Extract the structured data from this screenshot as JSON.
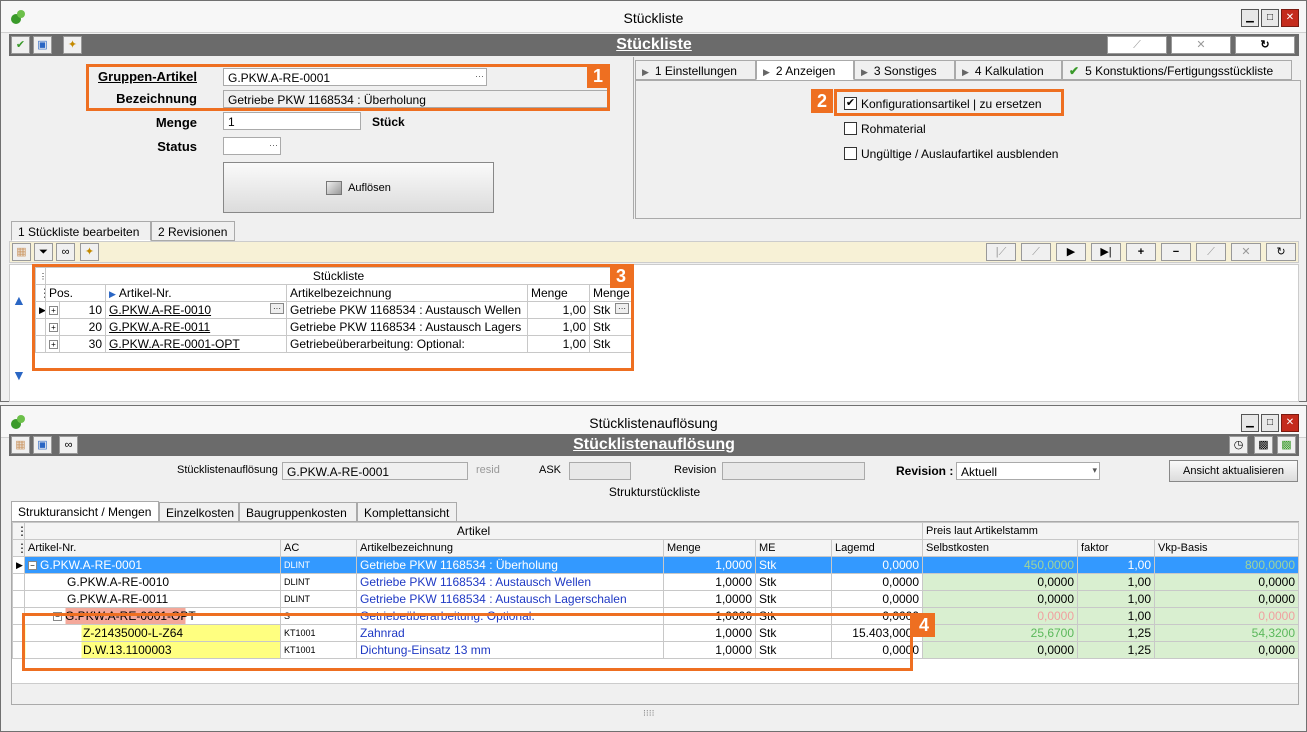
{
  "win1": {
    "title": "Stückliste",
    "header": "Stückliste",
    "form": {
      "gruppen_artikel_label": "Gruppen-Artikel",
      "gruppen_artikel_value": "G.PKW.A-RE-0001",
      "bezeichnung_label": "Bezeichnung",
      "bezeichnung_value": "Getriebe PKW 1168534 : Überholung",
      "menge_label": "Menge",
      "menge_value": "1",
      "menge_unit": "Stück",
      "status_label": "Status",
      "resolve_button": "Auflösen"
    },
    "right_tabs": [
      "1 Einstellungen",
      "2 Anzeigen",
      "3 Sonstiges",
      "4 Kalkulation",
      "5 Konstuktions/Fertigungsstückliste"
    ],
    "checks": [
      {
        "label": "Konfigurationsartikel | zu ersetzen",
        "checked": true
      },
      {
        "label": "Rohmaterial",
        "checked": false
      },
      {
        "label": "Ungültige / Auslaufartikel ausblenden",
        "checked": false
      }
    ],
    "bottom_tabs": [
      "1 Stückliste bearbeiten",
      "2 Revisionen"
    ],
    "grid": {
      "title": "Stückliste",
      "headers": [
        "Pos.",
        "Artikel-Nr.",
        "Artikelbezeichnung",
        "Menge",
        "Menge"
      ],
      "rows": [
        [
          "10",
          "G.PKW.A-RE-0010",
          "Getriebe PKW 1168534 : Austausch Wellen",
          "1,00",
          "Stk"
        ],
        [
          "20",
          "G.PKW.A-RE-0011",
          "Getriebe PKW 1168534 : Austausch Lagers",
          "1,00",
          "Stk"
        ],
        [
          "30",
          "G.PKW.A-RE-0001-OPT",
          "Getriebeüberarbeitung: Optional:",
          "1,00",
          "Stk"
        ]
      ]
    }
  },
  "win2": {
    "title": "Stücklistenauflösung",
    "header": "Stücklistenauflösung",
    "filter": {
      "label1": "Stücklistenauflösung",
      "value1": "G.PKW.A-RE-0001",
      "resid": "resid",
      "ask": "ASK",
      "revision_label": "Revision",
      "revision_bold_label": "Revision :",
      "revision_value": "Aktuell",
      "refresh_button": "Ansicht aktualisieren",
      "subtitle": "Strukturstückliste"
    },
    "tabs": [
      "Strukturansicht / Mengen",
      "Einzelkosten",
      "Baugruppenkosten",
      "Komplettansicht"
    ],
    "group_headers": {
      "artikel": "Artikel",
      "preis": "Preis laut Artikelstamm"
    },
    "headers": [
      "Artikel-Nr.",
      "AC",
      "Artikelbezeichnung",
      "Menge",
      "ME",
      "Lagemd",
      "Selbstkosten",
      "faktor",
      "Vkp-Basis"
    ],
    "rows": [
      {
        "art": "G.PKW.A-RE-0001",
        "ac": "DLINT",
        "bez": "Getriebe PKW 1168534 : Überholung",
        "menge": "1,0000",
        "me": "Stk",
        "lager": "0,0000",
        "sk": "450,0000",
        "fak": "1,00",
        "vkp": "800,0000"
      },
      {
        "art": "G.PKW.A-RE-0010",
        "ac": "DLINT",
        "bez": "Getriebe PKW 1168534 : Austausch Wellen",
        "menge": "1,0000",
        "me": "Stk",
        "lager": "0,0000",
        "sk": "0,0000",
        "fak": "1,00",
        "vkp": "0,0000"
      },
      {
        "art": "G.PKW.A-RE-0011",
        "ac": "DLINT",
        "bez": "Getriebe PKW 1168534 : Austausch Lagerschalen",
        "menge": "1,0000",
        "me": "Stk",
        "lager": "0,0000",
        "sk": "0,0000",
        "fak": "1,00",
        "vkp": "0,0000"
      },
      {
        "art": "G.PKW.A-RE-0001-OPT",
        "ac": "S",
        "bez": "Getriebeüberarbeitung: Optional:",
        "menge": "1,0000",
        "me": "Stk",
        "lager": "0,0000",
        "sk": "0,0000",
        "fak": "1,00",
        "vkp": "0,0000"
      },
      {
        "art": "Z-21435000-L-Z64",
        "ac": "KT1001",
        "bez": "Zahnrad",
        "menge": "1,0000",
        "me": "Stk",
        "lager": "15.403,0000",
        "sk": "25,6700",
        "fak": "1,25",
        "vkp": "54,3200"
      },
      {
        "art": "D.W.13.1100003",
        "ac": "KT1001",
        "bez": "Dichtung-Einsatz 13 mm",
        "menge": "1,0000",
        "me": "Stk",
        "lager": "0,0000",
        "sk": "0,0000",
        "fak": "1,25",
        "vkp": "0,0000"
      }
    ]
  },
  "badges": [
    "1",
    "2",
    "3",
    "4"
  ],
  "colors": {
    "accent": "#ee6f21",
    "header_bar": "#6b6b6b",
    "selected_row": "#3399ff",
    "green_cell": "#d9efd0",
    "yellow_cell": "#ffff80",
    "salmon_cell": "#f4a89a"
  }
}
